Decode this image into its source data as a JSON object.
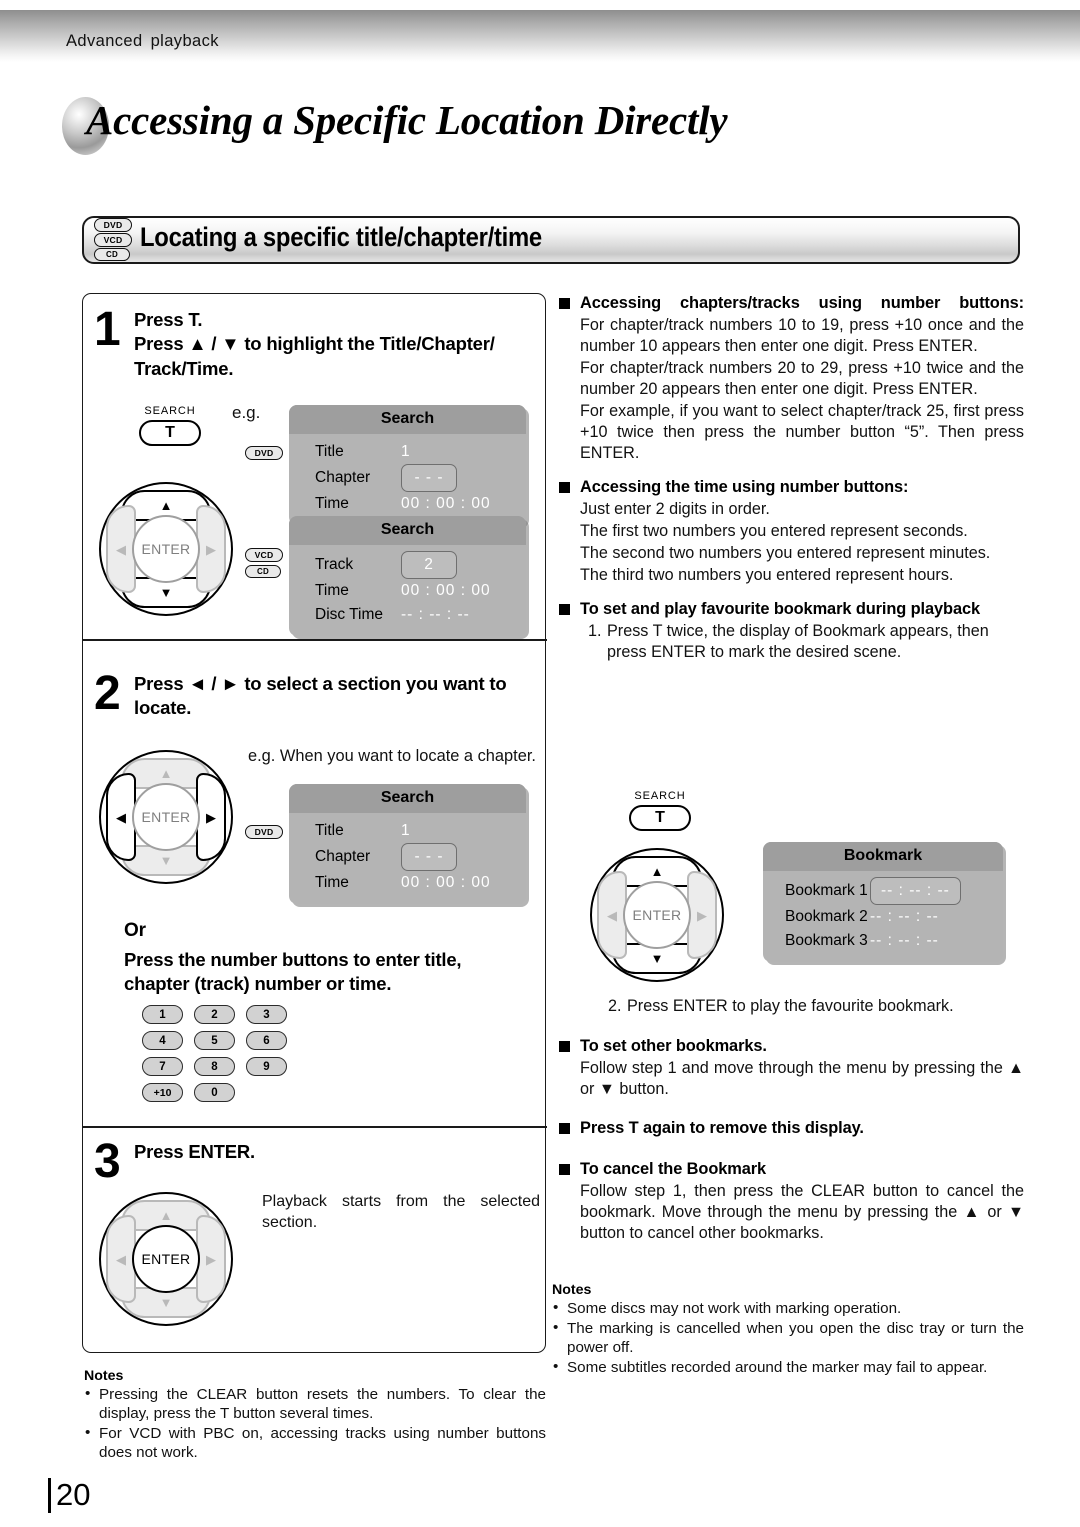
{
  "runhead": "Advanced  playback",
  "page_title": "Accessing a Specific Location Directly",
  "folio": "20",
  "section": {
    "title": "Locating a specific title/chapter/time",
    "discs": [
      "DVD",
      "VCD",
      "CD"
    ]
  },
  "colors": {
    "osd_header": "#9e9e9e",
    "osd_body": "#b4b4b4",
    "osd_value": "#ffffff",
    "key_fill": "#d2d2d2",
    "pad_inactive": "#b9b9b9"
  },
  "steps": [
    {
      "num": "1",
      "head_line1": "Press T.",
      "head_line2": "Press ▲ / ▼ to highlight the Title/Chapter/",
      "head_line3": "Track/Time.",
      "eg_label": "e.g.",
      "remote": {
        "search_label": "SEARCH",
        "t_label": "T",
        "enter_label": "ENTER",
        "active_pads": "up-down"
      },
      "panels": [
        {
          "disc_tags": [
            "DVD"
          ],
          "title": "Search",
          "rows": [
            {
              "label": "Title",
              "value": "1",
              "boxed": false
            },
            {
              "label": "Chapter",
              "value": "- - -",
              "boxed": true
            },
            {
              "label": "Time",
              "value": "00 : 00 : 00",
              "boxed": false
            }
          ]
        },
        {
          "disc_tags": [
            "VCD",
            "CD"
          ],
          "title": "Search",
          "rows": [
            {
              "label": "Track",
              "value": "2",
              "boxed": true
            },
            {
              "label": "Time",
              "value": "00 : 00 : 00",
              "boxed": false
            },
            {
              "label": "Disc Time",
              "value": "-- : -- : --",
              "boxed": false
            }
          ]
        }
      ]
    },
    {
      "num": "2",
      "head_line1": "Press ◄ / ► to select a section you want to",
      "head_line2": "locate.",
      "eg_text": "e.g. When you want to locate a chapter.",
      "remote": {
        "enter_label": "ENTER",
        "active_pads": "left-right"
      },
      "panel": {
        "disc_tags": [
          "DVD"
        ],
        "title": "Search",
        "rows": [
          {
            "label": "Title",
            "value": "1",
            "boxed": false
          },
          {
            "label": "Chapter",
            "value": "- - -",
            "boxed": true
          },
          {
            "label": "Time",
            "value": "00 : 00 : 00",
            "boxed": false
          }
        ]
      },
      "or_label": "Or",
      "or_head_line1": "Press the number buttons to enter title,",
      "or_head_line2": "chapter (track) number or time.",
      "keys": [
        "1",
        "2",
        "3",
        "4",
        "5",
        "6",
        "7",
        "8",
        "9",
        "+10",
        "0"
      ]
    },
    {
      "num": "3",
      "head_line1": "Press ENTER.",
      "body_line1": "Playback starts from the selected",
      "body_line2": "section.",
      "remote": {
        "enter_label": "ENTER",
        "active_pads": "center"
      }
    }
  ],
  "left_notes": {
    "title": "Notes",
    "items": [
      "Pressing the CLEAR button resets the numbers. To clear the display, press the T button several times.",
      "For VCD with PBC on, accessing tracks using number buttons does not work."
    ]
  },
  "right_blocks": [
    {
      "head": "Accessing chapters/tracks using number buttons:",
      "paras": [
        "For chapter/track numbers 10 to 19, press +10 once and the number 10 appears then enter one digit. Press ENTER.",
        "For chapter/track numbers 20 to 29, press +10 twice and the number 20 appears then enter one digit. Press ENTER.",
        "For example, if you want to select chapter/track 25, first press +10 twice then press the number button “5”. Then press ENTER."
      ]
    },
    {
      "head": "Accessing the time using number buttons:",
      "paras": [
        "Just enter 2 digits in order.",
        "The first two numbers you entered represent seconds.",
        "The second two numbers you entered represent minutes.",
        "The third two numbers you entered represent hours."
      ]
    },
    {
      "head": "To set and play favourite bookmark during playback",
      "ordered": [
        {
          "num": "1.",
          "text": "Press T twice, the display of Bookmark appears, then press ENTER to mark the desired scene."
        }
      ],
      "bookmark_remote": {
        "search_label": "SEARCH",
        "t_label": "T",
        "enter_label": "ENTER",
        "active_pads": "up-down"
      },
      "bookmark_panel": {
        "title": "Bookmark",
        "rows": [
          {
            "label": "Bookmark 1",
            "value": "-- : -- : --",
            "boxed": true
          },
          {
            "label": "Bookmark 2",
            "value": "-- : -- : --",
            "boxed": false
          },
          {
            "label": "Bookmark 3",
            "value": "-- : -- : --",
            "boxed": false
          }
        ]
      },
      "ordered2": [
        {
          "num": "2.",
          "text": "Press ENTER to play the favourite bookmark."
        }
      ]
    },
    {
      "head": "To set other bookmarks.",
      "paras": [
        "Follow step 1 and move through the menu by pressing the ▲ or ▼ button."
      ]
    },
    {
      "head": "Press T again to remove this display.",
      "paras": []
    },
    {
      "head": "To cancel the Bookmark",
      "paras": [
        "Follow step 1, then press the CLEAR button to cancel the bookmark. Move through the menu by pressing the ▲ or ▼ button to cancel other bookmarks."
      ]
    }
  ],
  "right_notes": {
    "title": "Notes",
    "items": [
      "Some discs may not work with marking operation.",
      "The marking is cancelled when you open the disc tray or turn the power off.",
      "Some subtitles recorded around the marker may fail to appear."
    ]
  }
}
